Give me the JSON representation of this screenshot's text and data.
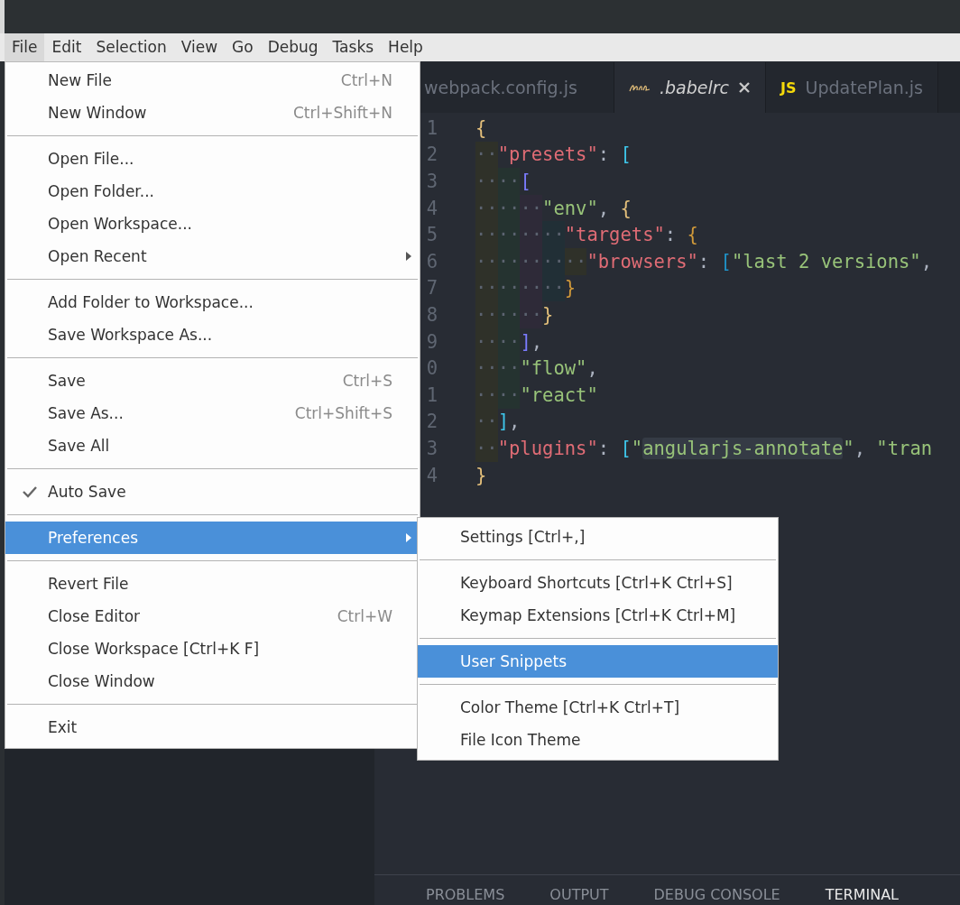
{
  "menu_bar": [
    {
      "label": "File",
      "selected": true
    },
    {
      "label": "Edit",
      "selected": false
    },
    {
      "label": "Selection",
      "selected": false
    },
    {
      "label": "View",
      "selected": false
    },
    {
      "label": "Go",
      "selected": false
    },
    {
      "label": "Debug",
      "selected": false
    },
    {
      "label": "Tasks",
      "selected": false
    },
    {
      "label": "Help",
      "selected": false
    }
  ],
  "editor_tabs": [
    {
      "label": "webpack.config.js",
      "selected": false
    },
    {
      "label": ".babelrc",
      "selected": true,
      "kind": "babel"
    },
    {
      "label": "UpdatePlan.js",
      "selected": false,
      "icon_text": "JS",
      "kind": "js"
    }
  ],
  "code_lines": [
    {
      "number": "1",
      "tokens": [
        {
          "kind": "brace",
          "text": "{"
        }
      ]
    },
    {
      "number": "2",
      "tokens": [
        {
          "kind": "indent",
          "text": "··"
        },
        {
          "kind": "key",
          "text": "\"presets\""
        },
        {
          "kind": "punct",
          "text": ": "
        },
        {
          "kind": "bracket-a",
          "text": "["
        }
      ]
    },
    {
      "number": "3",
      "tokens": [
        {
          "kind": "indent",
          "text": "··"
        },
        {
          "kind": "indent",
          "text": "··"
        },
        {
          "kind": "bracket-b",
          "text": "["
        }
      ]
    },
    {
      "number": "4",
      "tokens": [
        {
          "kind": "indent",
          "text": "··"
        },
        {
          "kind": "indent",
          "text": "··"
        },
        {
          "kind": "indent",
          "text": "··"
        },
        {
          "kind": "string",
          "text": "\"env\""
        },
        {
          "kind": "punct",
          "text": ", "
        },
        {
          "kind": "bracket-c",
          "text": "{"
        }
      ]
    },
    {
      "number": "5",
      "tokens": [
        {
          "kind": "indent",
          "text": "··"
        },
        {
          "kind": "indent",
          "text": "··"
        },
        {
          "kind": "indent",
          "text": "··"
        },
        {
          "kind": "indent",
          "text": "··"
        },
        {
          "kind": "key",
          "text": "\"targets\""
        },
        {
          "kind": "punct",
          "text": ": "
        },
        {
          "kind": "bracket-d",
          "text": "{"
        }
      ]
    },
    {
      "number": "6",
      "tokens": [
        {
          "kind": "indent",
          "text": "··"
        },
        {
          "kind": "indent",
          "text": "··"
        },
        {
          "kind": "indent",
          "text": "··"
        },
        {
          "kind": "indent",
          "text": "··"
        },
        {
          "kind": "indent",
          "text": "··"
        },
        {
          "kind": "key",
          "text": "\"browsers\""
        },
        {
          "kind": "punct",
          "text": ": "
        },
        {
          "kind": "bracket-e",
          "text": "["
        },
        {
          "kind": "string",
          "text": "\"last 2 versions\""
        },
        {
          "kind": "punct",
          "text": ","
        }
      ]
    },
    {
      "number": "7",
      "tokens": [
        {
          "kind": "indent",
          "text": "··"
        },
        {
          "kind": "indent",
          "text": "··"
        },
        {
          "kind": "indent",
          "text": "··"
        },
        {
          "kind": "indent",
          "text": "··"
        },
        {
          "kind": "bracket-d",
          "text": "}"
        }
      ]
    },
    {
      "number": "8",
      "tokens": [
        {
          "kind": "indent",
          "text": "··"
        },
        {
          "kind": "indent",
          "text": "··"
        },
        {
          "kind": "indent",
          "text": "··"
        },
        {
          "kind": "bracket-c",
          "text": "}"
        }
      ]
    },
    {
      "number": "9",
      "tokens": [
        {
          "kind": "indent",
          "text": "··"
        },
        {
          "kind": "indent",
          "text": "··"
        },
        {
          "kind": "bracket-b",
          "text": "]"
        },
        {
          "kind": "punct",
          "text": ","
        }
      ]
    },
    {
      "number": "0",
      "tokens": [
        {
          "kind": "indent",
          "text": "··"
        },
        {
          "kind": "indent",
          "text": "··"
        },
        {
          "kind": "string",
          "text": "\"flow\""
        },
        {
          "kind": "punct",
          "text": ","
        }
      ]
    },
    {
      "number": "1",
      "tokens": [
        {
          "kind": "indent",
          "text": "··"
        },
        {
          "kind": "indent",
          "text": "··"
        },
        {
          "kind": "string",
          "text": "\"react\""
        }
      ]
    },
    {
      "number": "2",
      "tokens": [
        {
          "kind": "indent",
          "text": "··"
        },
        {
          "kind": "bracket-a",
          "text": "]"
        },
        {
          "kind": "punct",
          "text": ","
        }
      ]
    },
    {
      "number": "3",
      "tokens": [
        {
          "kind": "indent",
          "text": "··"
        },
        {
          "kind": "key",
          "text": "\"plugins\""
        },
        {
          "kind": "punct",
          "text": ": "
        },
        {
          "kind": "bracket-a",
          "text": "["
        },
        {
          "kind": "string",
          "text": "\""
        },
        {
          "kind": "match",
          "text": "angularjs-annotate"
        },
        {
          "kind": "string",
          "text": "\""
        },
        {
          "kind": "punct",
          "text": ", "
        },
        {
          "kind": "string",
          "text": "\"tran"
        }
      ]
    },
    {
      "number": "4",
      "tokens": [
        {
          "kind": "brace",
          "text": "}"
        }
      ]
    }
  ],
  "panel_tabs": [
    {
      "label": "PROBLEMS",
      "selected": false
    },
    {
      "label": "OUTPUT",
      "selected": false
    },
    {
      "label": "DEBUG CONSOLE",
      "selected": false
    },
    {
      "label": "TERMINAL",
      "selected": true
    }
  ],
  "file_menu": [
    {
      "kind": "item",
      "label": "New File",
      "shortcut": "Ctrl+N",
      "submenu": false,
      "checked": false,
      "selected": false
    },
    {
      "kind": "item",
      "label": "New Window",
      "shortcut": "Ctrl+Shift+N",
      "submenu": false,
      "checked": false,
      "selected": false
    },
    {
      "kind": "separator"
    },
    {
      "kind": "item",
      "label": "Open File...",
      "submenu": false,
      "checked": false,
      "selected": false
    },
    {
      "kind": "item",
      "label": "Open Folder...",
      "submenu": false,
      "checked": false,
      "selected": false
    },
    {
      "kind": "item",
      "label": "Open Workspace...",
      "submenu": false,
      "checked": false,
      "selected": false
    },
    {
      "kind": "item",
      "label": "Open Recent",
      "submenu": true,
      "checked": false,
      "selected": false
    },
    {
      "kind": "separator"
    },
    {
      "kind": "item",
      "label": "Add Folder to Workspace...",
      "submenu": false,
      "checked": false,
      "selected": false
    },
    {
      "kind": "item",
      "label": "Save Workspace As...",
      "submenu": false,
      "checked": false,
      "selected": false
    },
    {
      "kind": "separator"
    },
    {
      "kind": "item",
      "label": "Save",
      "shortcut": "Ctrl+S",
      "submenu": false,
      "checked": false,
      "selected": false
    },
    {
      "kind": "item",
      "label": "Save As...",
      "shortcut": "Ctrl+Shift+S",
      "submenu": false,
      "checked": false,
      "selected": false
    },
    {
      "kind": "item",
      "label": "Save All",
      "submenu": false,
      "checked": false,
      "selected": false
    },
    {
      "kind": "separator"
    },
    {
      "kind": "item",
      "label": "Auto Save",
      "submenu": false,
      "checked": true,
      "selected": false
    },
    {
      "kind": "separator"
    },
    {
      "kind": "item",
      "label": "Preferences",
      "submenu": true,
      "checked": false,
      "selected": true
    },
    {
      "kind": "separator"
    },
    {
      "kind": "item",
      "label": "Revert File",
      "submenu": false,
      "checked": false,
      "selected": false
    },
    {
      "kind": "item",
      "label": "Close Editor",
      "shortcut": "Ctrl+W",
      "submenu": false,
      "checked": false,
      "selected": false
    },
    {
      "kind": "item",
      "label": "Close Workspace [Ctrl+K F]",
      "submenu": false,
      "checked": false,
      "selected": false
    },
    {
      "kind": "item",
      "label": "Close Window",
      "submenu": false,
      "checked": false,
      "selected": false
    },
    {
      "kind": "separator"
    },
    {
      "kind": "item",
      "label": "Exit",
      "submenu": false,
      "checked": false,
      "selected": false
    }
  ],
  "preferences_submenu": [
    {
      "kind": "item",
      "label": "Settings [Ctrl+,]",
      "selected": false
    },
    {
      "kind": "separator"
    },
    {
      "kind": "item",
      "label": "Keyboard Shortcuts [Ctrl+K Ctrl+S]",
      "selected": false
    },
    {
      "kind": "item",
      "label": "Keymap Extensions [Ctrl+K Ctrl+M]",
      "selected": false
    },
    {
      "kind": "separator"
    },
    {
      "kind": "item",
      "label": "User Snippets",
      "selected": true
    },
    {
      "kind": "separator"
    },
    {
      "kind": "item",
      "label": "Color Theme [Ctrl+K Ctrl+T]",
      "selected": false
    },
    {
      "kind": "item",
      "label": "File Icon Theme",
      "selected": false
    }
  ]
}
